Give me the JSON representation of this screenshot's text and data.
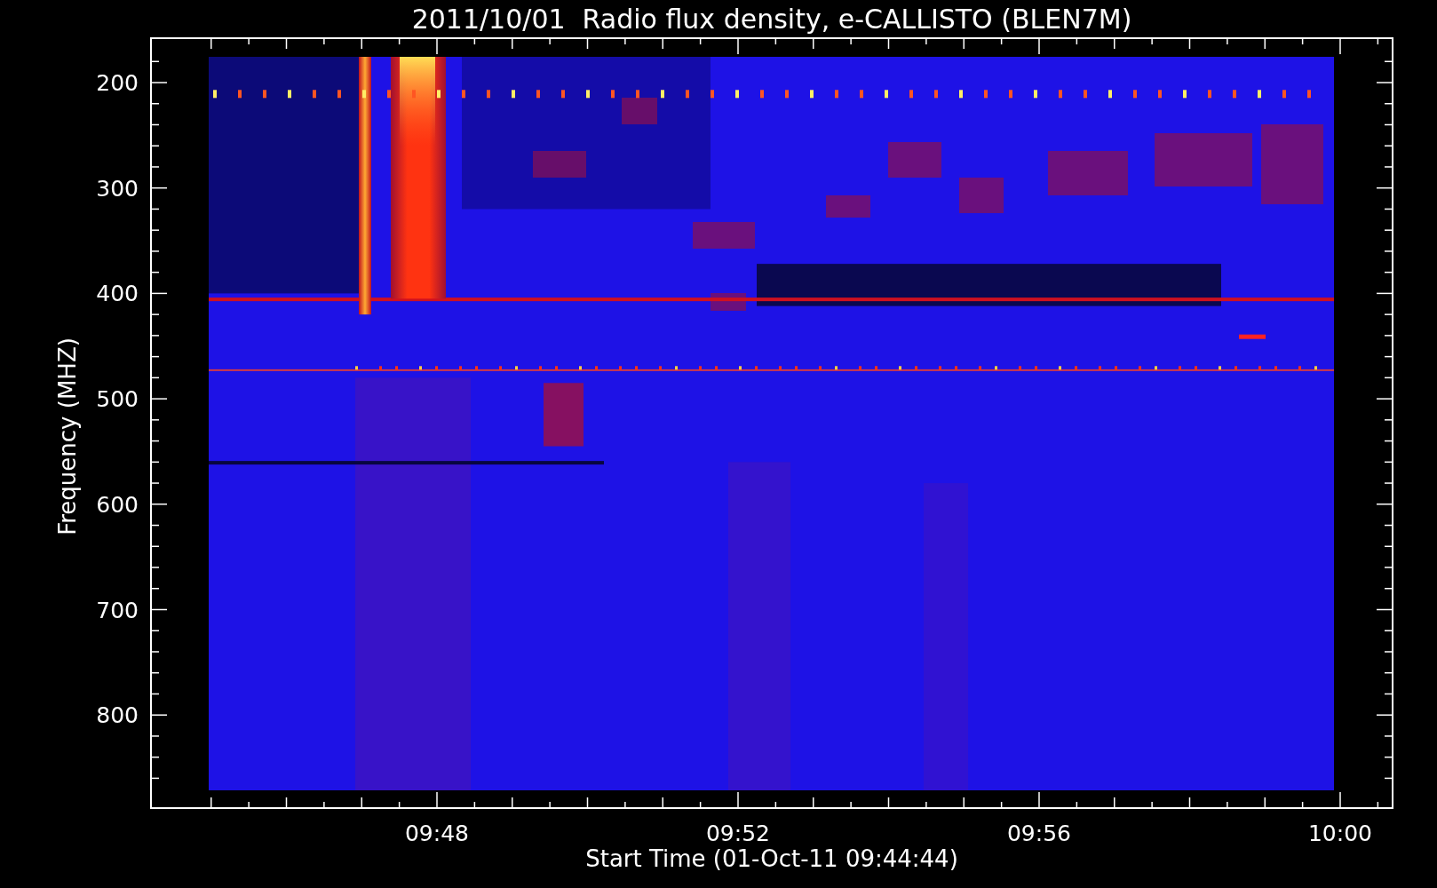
{
  "plot": {
    "title": "2011/10/01  Radio flux density, e-CALLISTO (BLEN7M)",
    "xlabel": "Start Time (01-Oct-11 09:44:44)",
    "ylabel": "Frequency (MHZ)",
    "xticks": [
      "09:48",
      "09:52",
      "09:56",
      "10:00"
    ],
    "yticks": [
      "200",
      "300",
      "400",
      "500",
      "600",
      "700",
      "800"
    ]
  }
}
